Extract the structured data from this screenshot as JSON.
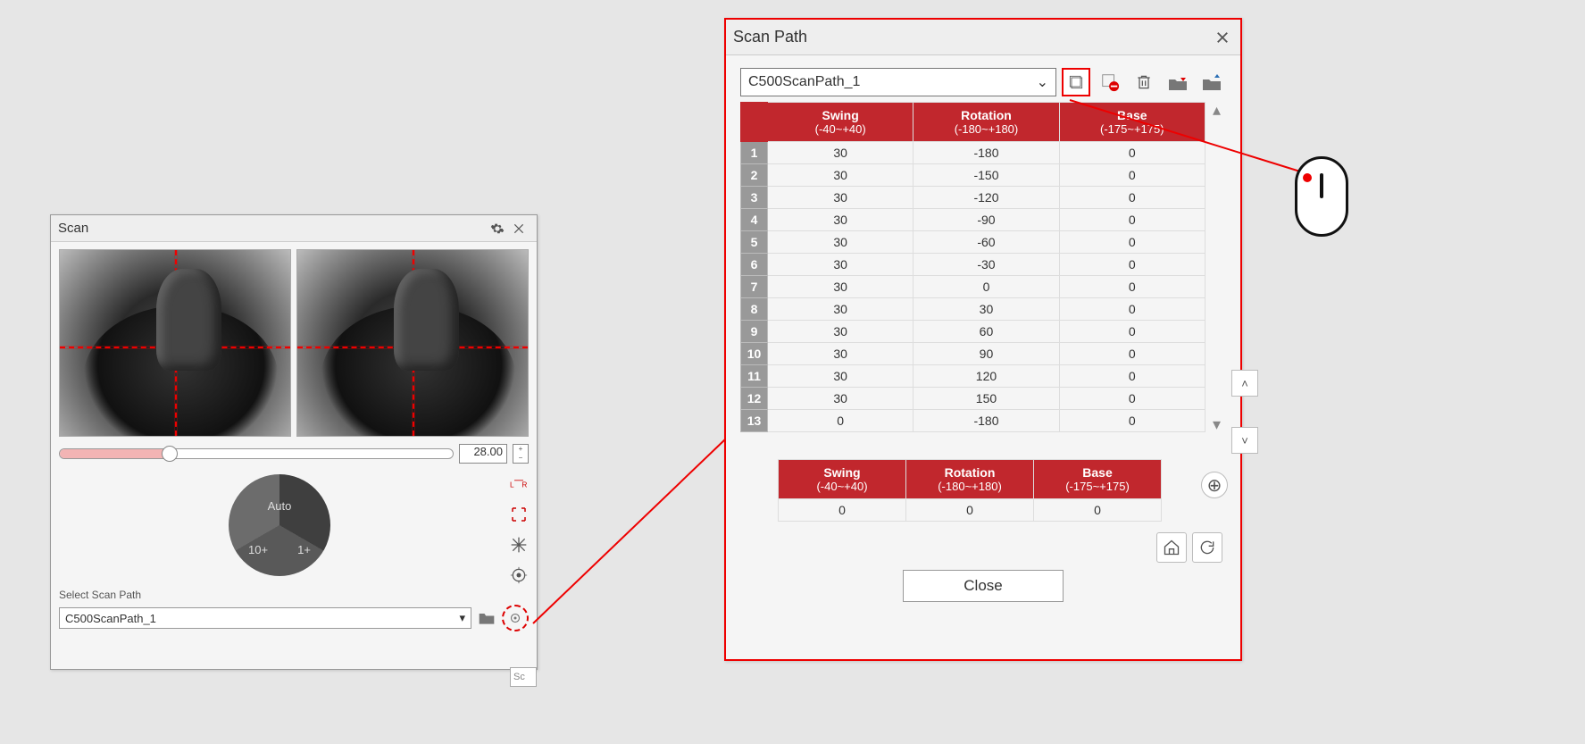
{
  "scan": {
    "title": "Scan",
    "exposure_value": "28.00",
    "pie": {
      "auto": "Auto",
      "ten": "10+",
      "one": "1+"
    },
    "select_label": "Select Scan Path",
    "select_value": "C500ScanPath_1"
  },
  "scanpath": {
    "title": "Scan Path",
    "combo_value": "C500ScanPath_1",
    "headers": {
      "swing": "Swing",
      "swing_range": "(-40~+40)",
      "rotation": "Rotation",
      "rotation_range": "(-180~+180)",
      "base": "Base",
      "base_range": "(-175~+175)"
    },
    "rows": [
      {
        "n": "1",
        "swing": "30",
        "rotation": "-180",
        "base": "0"
      },
      {
        "n": "2",
        "swing": "30",
        "rotation": "-150",
        "base": "0"
      },
      {
        "n": "3",
        "swing": "30",
        "rotation": "-120",
        "base": "0"
      },
      {
        "n": "4",
        "swing": "30",
        "rotation": "-90",
        "base": "0"
      },
      {
        "n": "5",
        "swing": "30",
        "rotation": "-60",
        "base": "0"
      },
      {
        "n": "6",
        "swing": "30",
        "rotation": "-30",
        "base": "0"
      },
      {
        "n": "7",
        "swing": "30",
        "rotation": "0",
        "base": "0"
      },
      {
        "n": "8",
        "swing": "30",
        "rotation": "30",
        "base": "0"
      },
      {
        "n": "9",
        "swing": "30",
        "rotation": "60",
        "base": "0"
      },
      {
        "n": "10",
        "swing": "30",
        "rotation": "90",
        "base": "0"
      },
      {
        "n": "11",
        "swing": "30",
        "rotation": "120",
        "base": "0"
      },
      {
        "n": "12",
        "swing": "30",
        "rotation": "150",
        "base": "0"
      },
      {
        "n": "13",
        "swing": "0",
        "rotation": "-180",
        "base": "0"
      }
    ],
    "single": {
      "swing": "0",
      "rotation": "0",
      "base": "0"
    },
    "close": "Close"
  },
  "sc_tab": "Sc"
}
